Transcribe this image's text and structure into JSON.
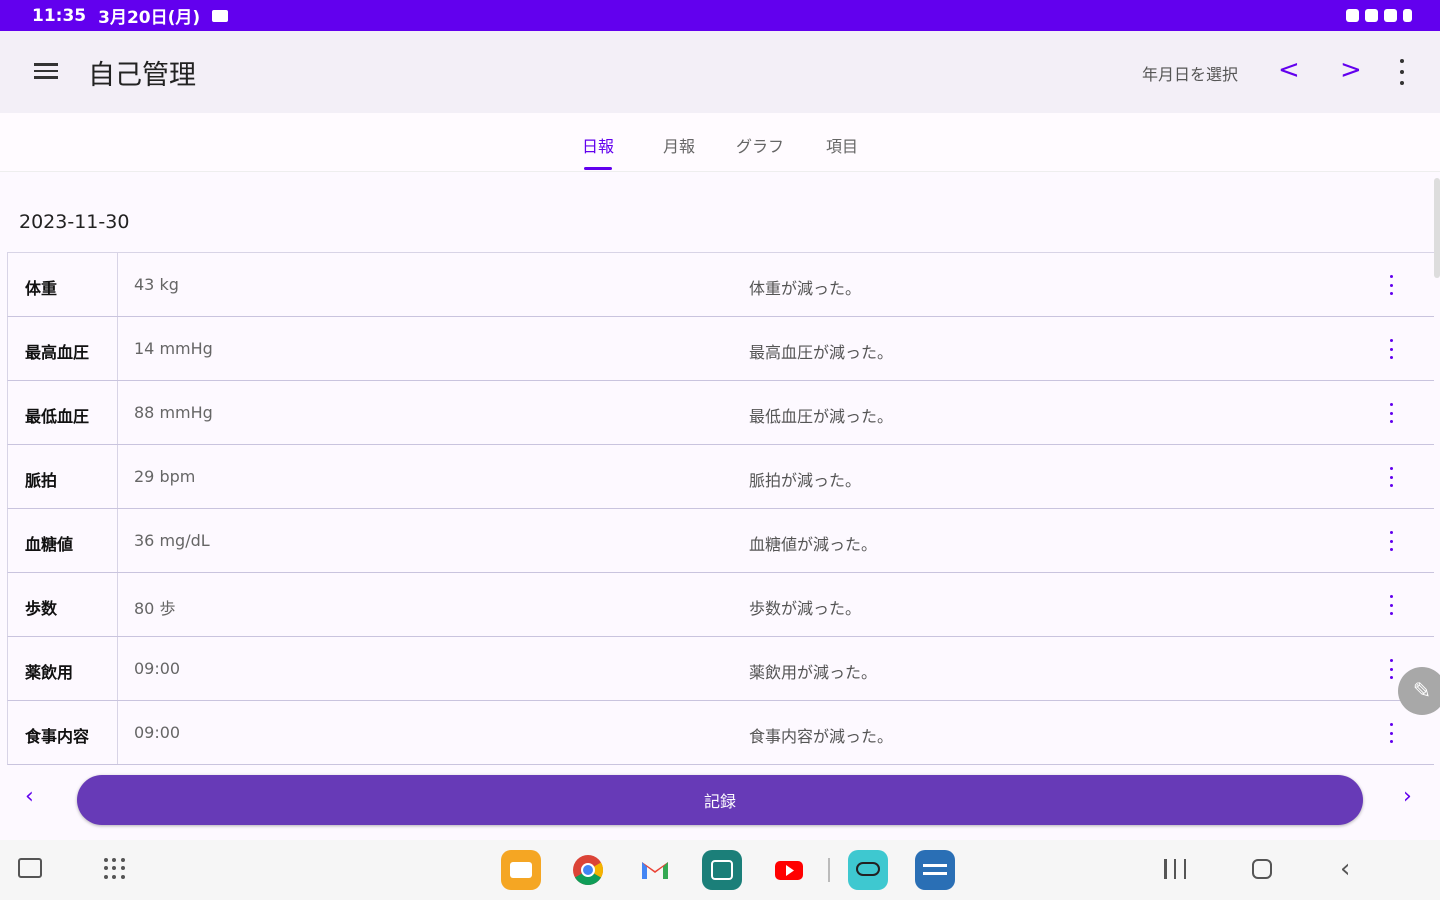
{
  "status_bar": {
    "time": "11:35",
    "date": "3月20日(月)"
  },
  "app_bar": {
    "title": "自己管理",
    "date_select_label": "年月日を選択",
    "prev_icon": "<",
    "next_icon": ">"
  },
  "tabs": [
    {
      "label": "日報",
      "active": true
    },
    {
      "label": "月報",
      "active": false
    },
    {
      "label": "グラフ",
      "active": false
    },
    {
      "label": "項目",
      "active": false
    }
  ],
  "date_header": "2023-11-30",
  "rows": [
    {
      "name": "体重",
      "value": "43 kg",
      "note": "体重が減った。"
    },
    {
      "name": "最高血圧",
      "value": "14 mmHg",
      "note": "最高血圧が減った。"
    },
    {
      "name": "最低血圧",
      "value": "88 mmHg",
      "note": "最低血圧が減った。"
    },
    {
      "name": "脈拍",
      "value": "29 bpm",
      "note": "脈拍が減った。"
    },
    {
      "name": "血糖値",
      "value": "36 mg/dL",
      "note": "血糖値が減った。"
    },
    {
      "name": "歩数",
      "value": "80 歩",
      "note": "歩数が減った。"
    },
    {
      "name": "薬飲用",
      "value": "09:00",
      "note": "薬飲用が減った。"
    },
    {
      "name": "食事内容",
      "value": "09:00",
      "note": "食事内容が減った。"
    }
  ],
  "record_button_label": "記録",
  "colors": {
    "primary": "#6200ee",
    "record_button": "#673ab7"
  },
  "taskbar_apps": [
    {
      "name": "my-files-icon",
      "color": "#f5a623"
    },
    {
      "name": "chrome-icon",
      "color": "#ffffff"
    },
    {
      "name": "gmail-icon",
      "color": "#ffffff"
    },
    {
      "name": "calendar-icon",
      "color": "#1b7f79"
    },
    {
      "name": "youtube-icon",
      "color": "#ffffff"
    },
    {
      "name": "amazon-icon",
      "color": "#3ec8d0"
    },
    {
      "name": "prime-video-icon",
      "color": "#2a6fb5"
    }
  ]
}
